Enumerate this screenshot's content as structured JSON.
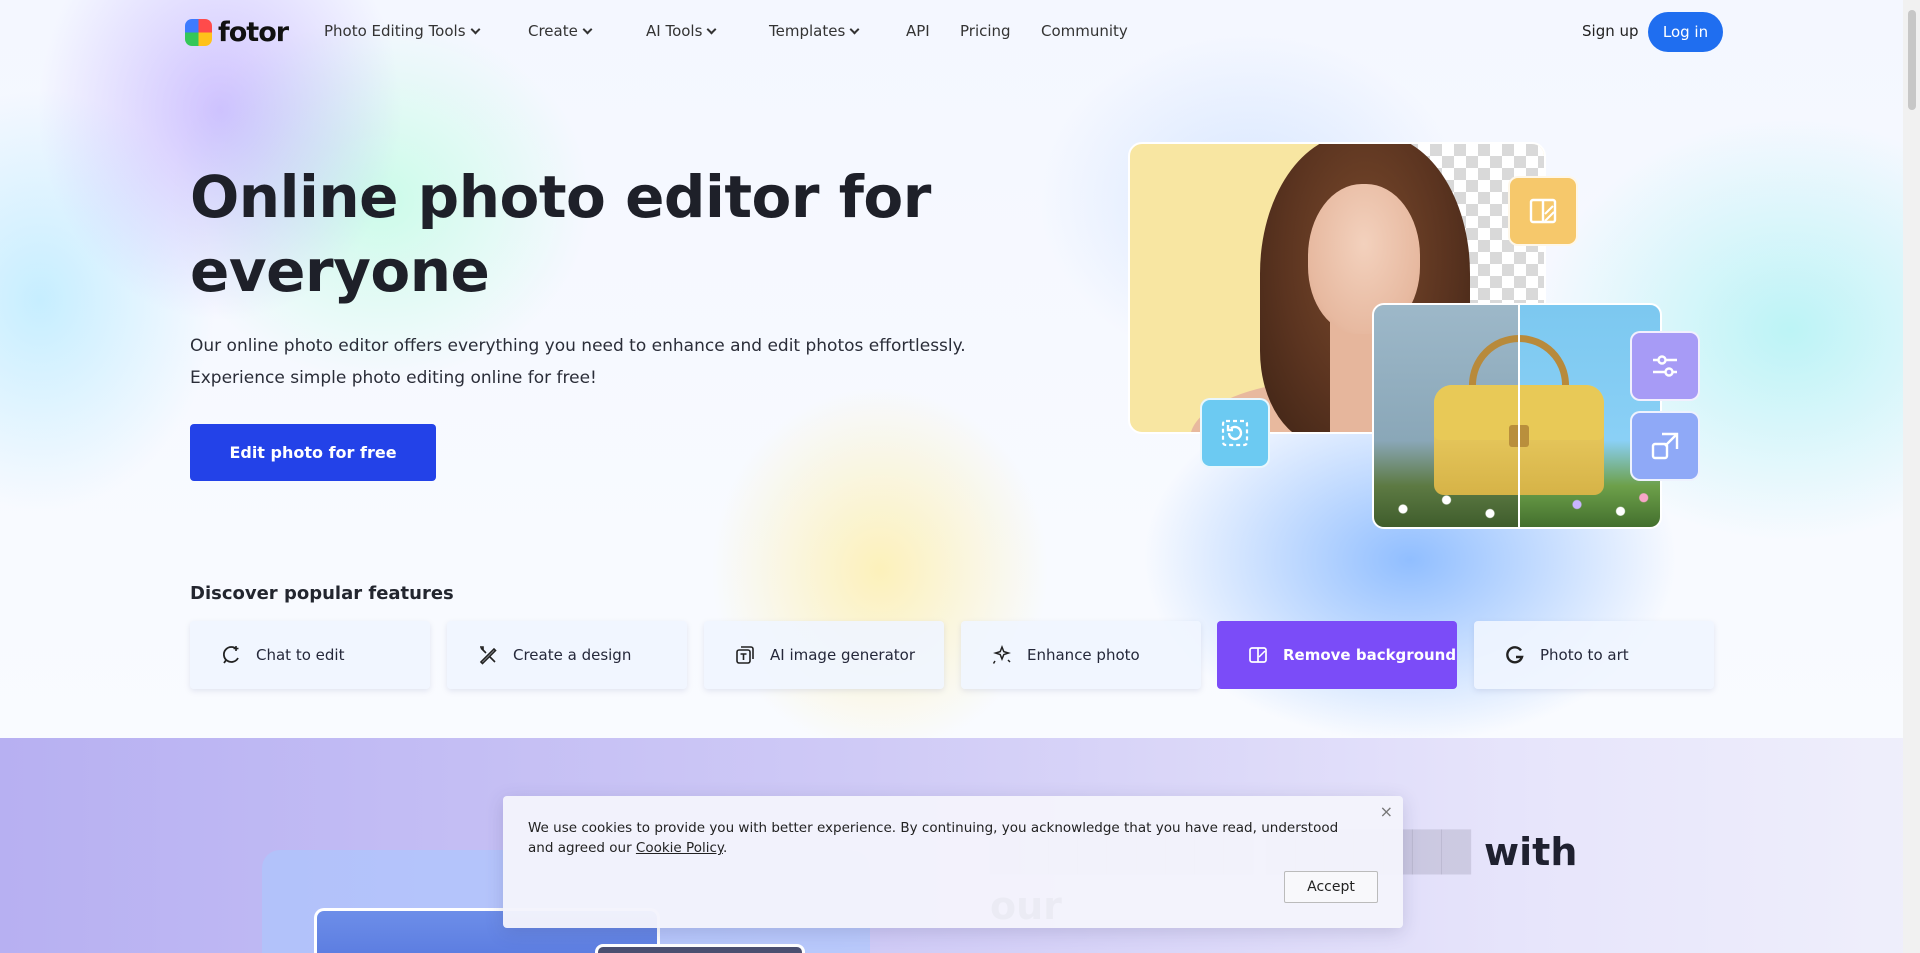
{
  "nav": {
    "logo": "fotor",
    "items": [
      {
        "label": "Photo Editing Tools",
        "dropdown": true
      },
      {
        "label": "Create",
        "dropdown": true
      },
      {
        "label": "AI Tools",
        "dropdown": true
      },
      {
        "label": "Templates",
        "dropdown": true
      },
      {
        "label": "API",
        "dropdown": false
      },
      {
        "label": "Pricing",
        "dropdown": false
      },
      {
        "label": "Community",
        "dropdown": false
      }
    ],
    "signup": "Sign up",
    "login": "Log in"
  },
  "hero": {
    "title": "Online photo editor for everyone",
    "subtitle_line1": "Our online photo editor offers everything you need to enhance and edit photos effortlessly.",
    "subtitle_line2": "Experience simple photo editing online for free!",
    "cta": "Edit photo for free"
  },
  "features": {
    "heading": "Discover popular features",
    "items": [
      {
        "label": "Chat to edit",
        "icon": "chat-edit-icon",
        "active": false
      },
      {
        "label": "Create a design",
        "icon": "design-tools-icon",
        "active": false
      },
      {
        "label": "AI image generator",
        "icon": "ai-image-icon",
        "active": false
      },
      {
        "label": "Enhance photo",
        "icon": "sparkle-icon",
        "active": false
      },
      {
        "label": "Remove background",
        "icon": "remove-background-icon",
        "active": true
      },
      {
        "label": "Photo to art",
        "icon": "art-icon",
        "active": false
      }
    ]
  },
  "lower": {
    "heading_visible": "with our"
  },
  "cookie": {
    "text": "We use cookies to provide you with better experience. By continuing, you acknowledge that you have read, understood and agreed our ",
    "link": "Cookie Policy",
    "period": ".",
    "close": "×",
    "accept": "Accept"
  },
  "colors": {
    "primary_blue": "#2342e8",
    "login_blue": "#1f6ef0",
    "active_purple": "#7b4cf8"
  }
}
